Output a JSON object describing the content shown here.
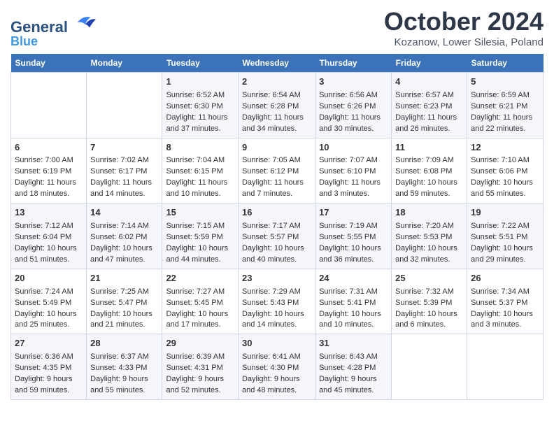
{
  "header": {
    "logo_line1": "General",
    "logo_line2": "Blue",
    "month_title": "October 2024",
    "subtitle": "Kozanow, Lower Silesia, Poland"
  },
  "weekdays": [
    "Sunday",
    "Monday",
    "Tuesday",
    "Wednesday",
    "Thursday",
    "Friday",
    "Saturday"
  ],
  "weeks": [
    [
      {
        "day": "",
        "info": ""
      },
      {
        "day": "",
        "info": ""
      },
      {
        "day": "1",
        "info": "Sunrise: 6:52 AM\nSunset: 6:30 PM\nDaylight: 11 hours and 37 minutes."
      },
      {
        "day": "2",
        "info": "Sunrise: 6:54 AM\nSunset: 6:28 PM\nDaylight: 11 hours and 34 minutes."
      },
      {
        "day": "3",
        "info": "Sunrise: 6:56 AM\nSunset: 6:26 PM\nDaylight: 11 hours and 30 minutes."
      },
      {
        "day": "4",
        "info": "Sunrise: 6:57 AM\nSunset: 6:23 PM\nDaylight: 11 hours and 26 minutes."
      },
      {
        "day": "5",
        "info": "Sunrise: 6:59 AM\nSunset: 6:21 PM\nDaylight: 11 hours and 22 minutes."
      }
    ],
    [
      {
        "day": "6",
        "info": "Sunrise: 7:00 AM\nSunset: 6:19 PM\nDaylight: 11 hours and 18 minutes."
      },
      {
        "day": "7",
        "info": "Sunrise: 7:02 AM\nSunset: 6:17 PM\nDaylight: 11 hours and 14 minutes."
      },
      {
        "day": "8",
        "info": "Sunrise: 7:04 AM\nSunset: 6:15 PM\nDaylight: 11 hours and 10 minutes."
      },
      {
        "day": "9",
        "info": "Sunrise: 7:05 AM\nSunset: 6:12 PM\nDaylight: 11 hours and 7 minutes."
      },
      {
        "day": "10",
        "info": "Sunrise: 7:07 AM\nSunset: 6:10 PM\nDaylight: 11 hours and 3 minutes."
      },
      {
        "day": "11",
        "info": "Sunrise: 7:09 AM\nSunset: 6:08 PM\nDaylight: 10 hours and 59 minutes."
      },
      {
        "day": "12",
        "info": "Sunrise: 7:10 AM\nSunset: 6:06 PM\nDaylight: 10 hours and 55 minutes."
      }
    ],
    [
      {
        "day": "13",
        "info": "Sunrise: 7:12 AM\nSunset: 6:04 PM\nDaylight: 10 hours and 51 minutes."
      },
      {
        "day": "14",
        "info": "Sunrise: 7:14 AM\nSunset: 6:02 PM\nDaylight: 10 hours and 47 minutes."
      },
      {
        "day": "15",
        "info": "Sunrise: 7:15 AM\nSunset: 5:59 PM\nDaylight: 10 hours and 44 minutes."
      },
      {
        "day": "16",
        "info": "Sunrise: 7:17 AM\nSunset: 5:57 PM\nDaylight: 10 hours and 40 minutes."
      },
      {
        "day": "17",
        "info": "Sunrise: 7:19 AM\nSunset: 5:55 PM\nDaylight: 10 hours and 36 minutes."
      },
      {
        "day": "18",
        "info": "Sunrise: 7:20 AM\nSunset: 5:53 PM\nDaylight: 10 hours and 32 minutes."
      },
      {
        "day": "19",
        "info": "Sunrise: 7:22 AM\nSunset: 5:51 PM\nDaylight: 10 hours and 29 minutes."
      }
    ],
    [
      {
        "day": "20",
        "info": "Sunrise: 7:24 AM\nSunset: 5:49 PM\nDaylight: 10 hours and 25 minutes."
      },
      {
        "day": "21",
        "info": "Sunrise: 7:25 AM\nSunset: 5:47 PM\nDaylight: 10 hours and 21 minutes."
      },
      {
        "day": "22",
        "info": "Sunrise: 7:27 AM\nSunset: 5:45 PM\nDaylight: 10 hours and 17 minutes."
      },
      {
        "day": "23",
        "info": "Sunrise: 7:29 AM\nSunset: 5:43 PM\nDaylight: 10 hours and 14 minutes."
      },
      {
        "day": "24",
        "info": "Sunrise: 7:31 AM\nSunset: 5:41 PM\nDaylight: 10 hours and 10 minutes."
      },
      {
        "day": "25",
        "info": "Sunrise: 7:32 AM\nSunset: 5:39 PM\nDaylight: 10 hours and 6 minutes."
      },
      {
        "day": "26",
        "info": "Sunrise: 7:34 AM\nSunset: 5:37 PM\nDaylight: 10 hours and 3 minutes."
      }
    ],
    [
      {
        "day": "27",
        "info": "Sunrise: 6:36 AM\nSunset: 4:35 PM\nDaylight: 9 hours and 59 minutes."
      },
      {
        "day": "28",
        "info": "Sunrise: 6:37 AM\nSunset: 4:33 PM\nDaylight: 9 hours and 55 minutes."
      },
      {
        "day": "29",
        "info": "Sunrise: 6:39 AM\nSunset: 4:31 PM\nDaylight: 9 hours and 52 minutes."
      },
      {
        "day": "30",
        "info": "Sunrise: 6:41 AM\nSunset: 4:30 PM\nDaylight: 9 hours and 48 minutes."
      },
      {
        "day": "31",
        "info": "Sunrise: 6:43 AM\nSunset: 4:28 PM\nDaylight: 9 hours and 45 minutes."
      },
      {
        "day": "",
        "info": ""
      },
      {
        "day": "",
        "info": ""
      }
    ]
  ]
}
